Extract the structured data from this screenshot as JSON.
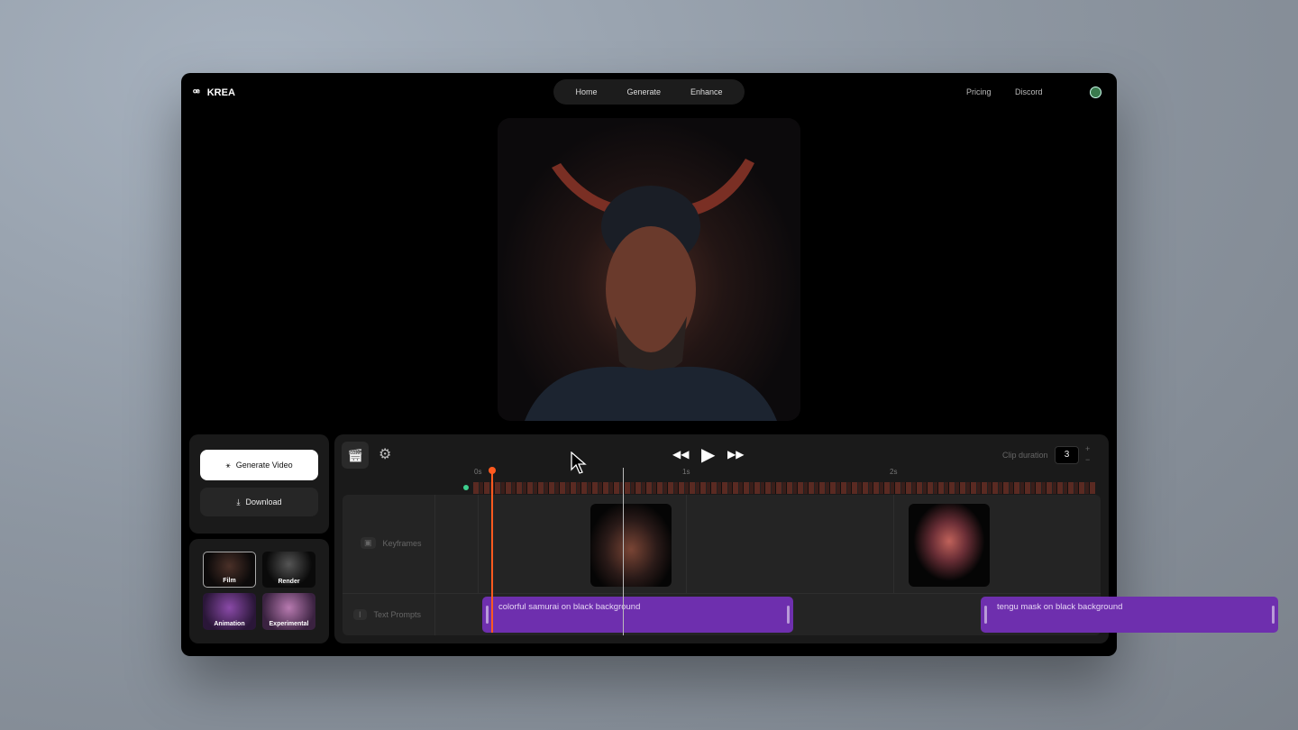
{
  "app": {
    "name": "KREA"
  },
  "nav": {
    "items": [
      "Home",
      "Generate",
      "Enhance"
    ],
    "pricing": "Pricing",
    "discord": "Discord"
  },
  "actions": {
    "generate": "Generate Video",
    "download": "Download"
  },
  "styles": [
    "Film",
    "Render",
    "Animation",
    "Experimental"
  ],
  "timeline": {
    "clip_duration_label": "Clip duration",
    "clip_duration": "3",
    "ticks": [
      "0s",
      "1s",
      "2s"
    ],
    "tracks": {
      "keyframes": "Keyframes",
      "text_prompts": "Text Prompts"
    },
    "prompts": [
      "colorful samurai on black background",
      "tengu mask on black background"
    ],
    "plus": "+",
    "minus": "−"
  },
  "colors": {
    "accent": "#6e2fae",
    "playhead": "#ff5a1f"
  }
}
